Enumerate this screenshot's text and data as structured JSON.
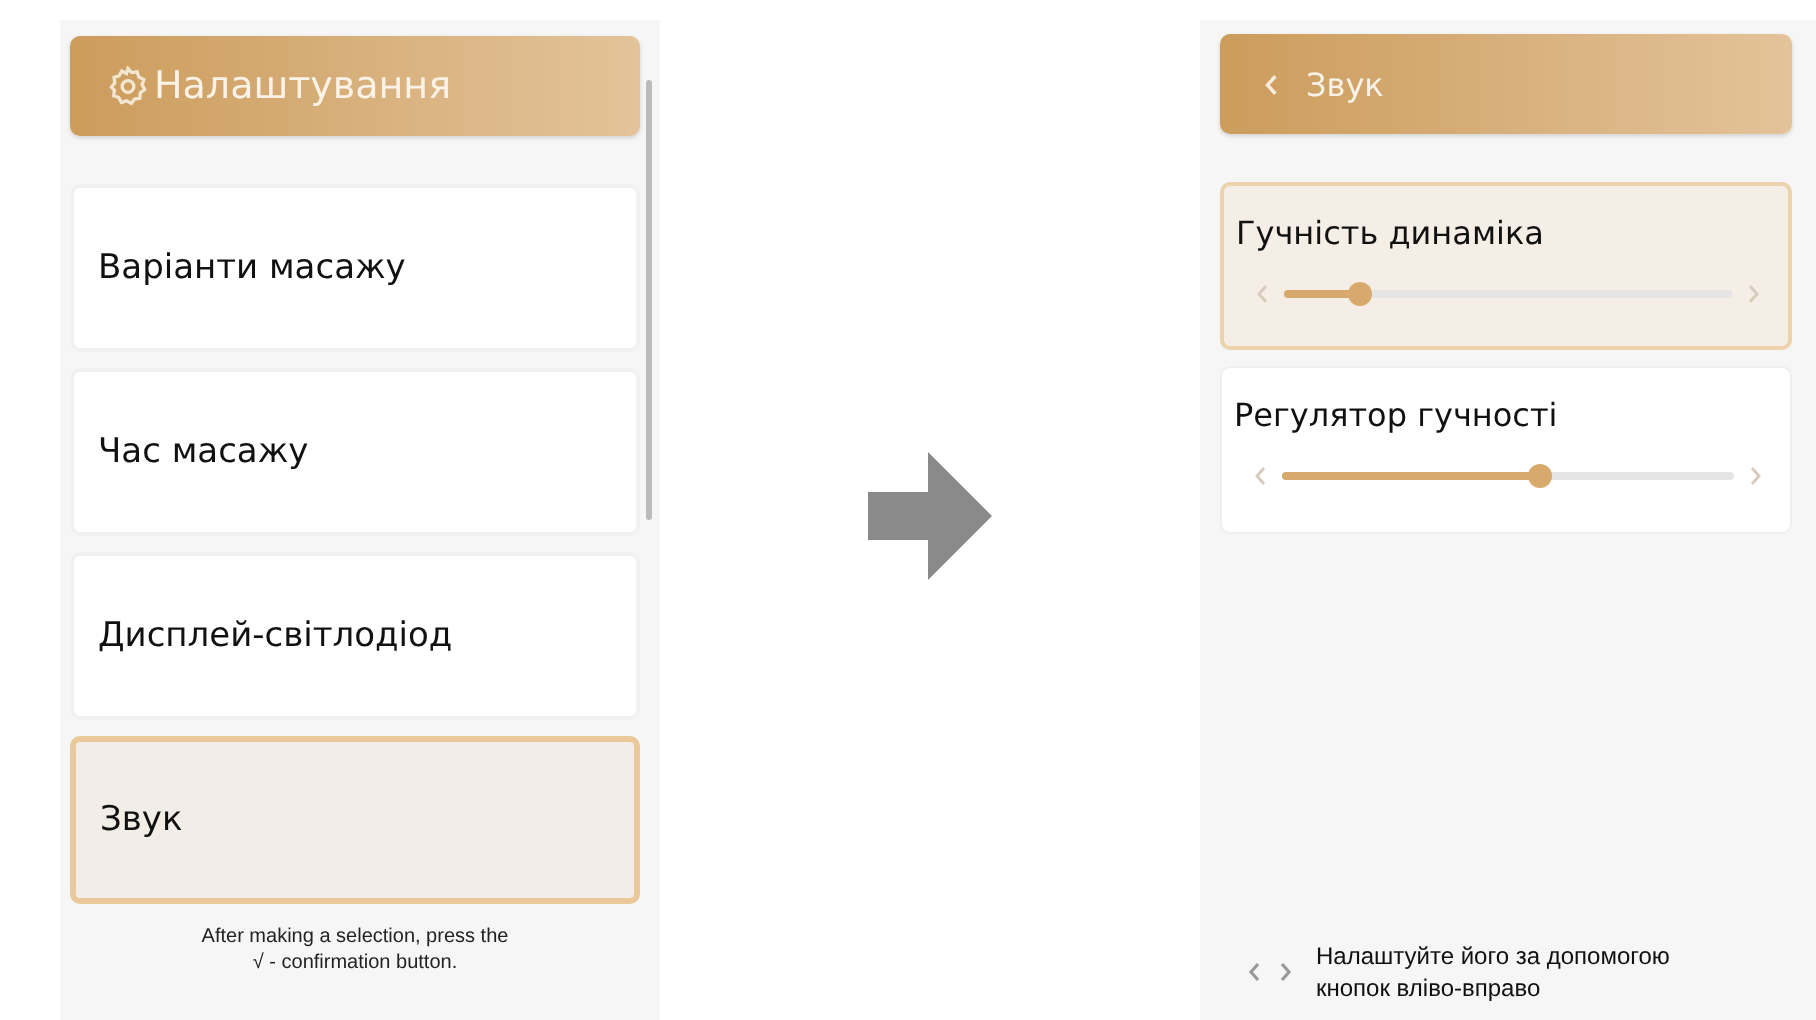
{
  "settings_screen": {
    "title": "Налаштування",
    "items": [
      {
        "label": "Варіанти масажу",
        "selected": false
      },
      {
        "label": "Час масажу",
        "selected": false
      },
      {
        "label": "Дисплей-світлодіод",
        "selected": false
      },
      {
        "label": "Звук",
        "selected": true
      }
    ],
    "note": "After making a selection, press the\n√ - confirmation button."
  },
  "sound_screen": {
    "title": "Звук",
    "sliders": [
      {
        "label": "Гучність динаміка",
        "selected": true,
        "level": 0.17
      },
      {
        "label": "Регулятор гучності",
        "selected": false,
        "level": 0.57
      }
    ],
    "hint": "Налаштуйте його за допомогою\nкнопок вліво-вправо"
  }
}
